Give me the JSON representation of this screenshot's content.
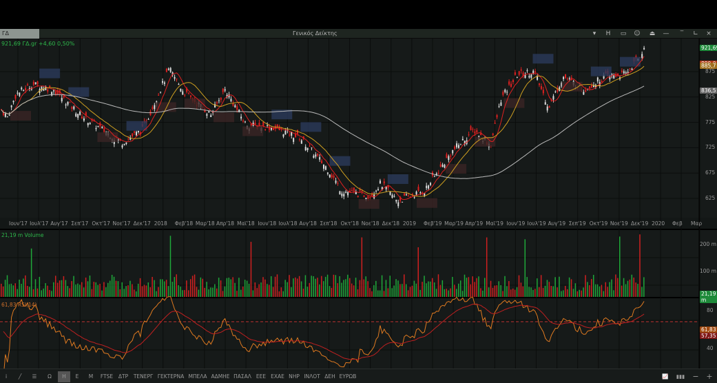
{
  "window": {
    "tab": "ΓΔ",
    "title": "Γενικός Δείκτης",
    "buttons": [
      "▾",
      "H",
      "▭",
      "☺",
      "⏏",
      "—",
      "‾",
      "∟",
      "×"
    ]
  },
  "info": "921,69 ΓΔ.gr +4,60 0,50%",
  "price_axis": {
    "ticks": [
      625,
      675,
      725,
      775,
      825,
      875
    ],
    "tick_labels": [
      "625",
      "675",
      "725",
      "775",
      "825",
      "875"
    ],
    "tags": [
      {
        "text": "921,69",
        "value": 921.69,
        "color": "#1e8a3a"
      },
      {
        "text": "890,0",
        "value": 890,
        "color": "#b03a1a"
      },
      {
        "text": "885,7",
        "value": 885.7,
        "color": "#a07020"
      },
      {
        "text": "836,5",
        "value": 836.5,
        "color": "#666666"
      }
    ]
  },
  "date_axis": [
    "Ιουν'17",
    "Ιουλ'17",
    "Αυγ'17",
    "Σεπ'17",
    "Οκτ'17",
    "Νοε'17",
    "Δεκ'17",
    "2018",
    "Φεβ'18",
    "Μαρ'18",
    "Απρ'18",
    "Μαϊ'18",
    "Ιουν'18",
    "Ιουλ'18",
    "Αυγ'18",
    "Σεπ'18",
    "Οκτ'18",
    "Νοε'18",
    "Δεκ'18",
    "2019",
    "Φεβ'19",
    "Μαρ'19",
    "Απρ'19",
    "Μαϊ'19",
    "Ιουν'19",
    "Ιουλ'19",
    "Αυγ'19",
    "Σεπ'19",
    "Οκτ'19",
    "Νοε'19",
    "Δεκ'19",
    "2020",
    "Φεβ",
    "Μαρ"
  ],
  "volume": {
    "title": "21,19 m Volume",
    "ticks": [
      "200 m",
      "100 m"
    ],
    "last": "21,19 m"
  },
  "rsi": {
    "title": "61,83 RSI(14)",
    "ticks": [
      "80",
      "40"
    ],
    "last": "61,83",
    "signal": "57,35"
  },
  "toolbar": [
    "i",
    "╱",
    "☰",
    "Ω",
    "Η",
    "Ε",
    "Μ",
    "FTSE",
    "ΔΤΡ",
    "ΤΕΝΕΡΓ",
    "ΓΕΚΤΕΡΝΑ",
    "ΜΠΕΛΑ",
    "ΑΔΜΗΕ",
    "ΠΑΣΑΛ",
    "ΕΕΕ",
    "ΕΧΑΕ",
    "ΝΗΡ",
    "ΙΝΛΟΤ",
    "ΔΕΗ",
    "ΕΥΡΩΒ"
  ],
  "toolbar_active": "Η",
  "toolbar_right": [
    "indicator-chart",
    "bar-chart",
    "−",
    "+"
  ],
  "chart_data": {
    "type": "candlestick",
    "title": "Γενικός Δείκτης",
    "ylim": [
      600,
      935
    ],
    "x_unit": "months since Jun 2017",
    "path": [
      [
        0,
        800
      ],
      [
        0.3,
        785
      ],
      [
        0.7,
        830
      ],
      [
        1.5,
        850
      ],
      [
        2.5,
        840
      ],
      [
        3.8,
        790
      ],
      [
        5.8,
        735
      ],
      [
        6.8,
        760
      ],
      [
        8.1,
        880
      ],
      [
        8.8,
        835
      ],
      [
        10.1,
        790
      ],
      [
        10.8,
        840
      ],
      [
        11.8,
        770
      ],
      [
        13.1,
        765
      ],
      [
        14.4,
        745
      ],
      [
        15.8,
        680
      ],
      [
        16.4,
        640
      ],
      [
        17.8,
        630
      ],
      [
        18.3,
        655
      ],
      [
        19.1,
        620
      ],
      [
        20.4,
        640
      ],
      [
        21.8,
        720
      ],
      [
        22.8,
        760
      ],
      [
        23.6,
        730
      ],
      [
        24.1,
        820
      ],
      [
        24.9,
        870
      ],
      [
        25.7,
        875
      ],
      [
        26.4,
        805
      ],
      [
        27.1,
        865
      ],
      [
        28.1,
        840
      ],
      [
        29.1,
        865
      ],
      [
        30.1,
        870
      ],
      [
        30.7,
        900
      ],
      [
        31,
        921.69
      ]
    ]
  }
}
